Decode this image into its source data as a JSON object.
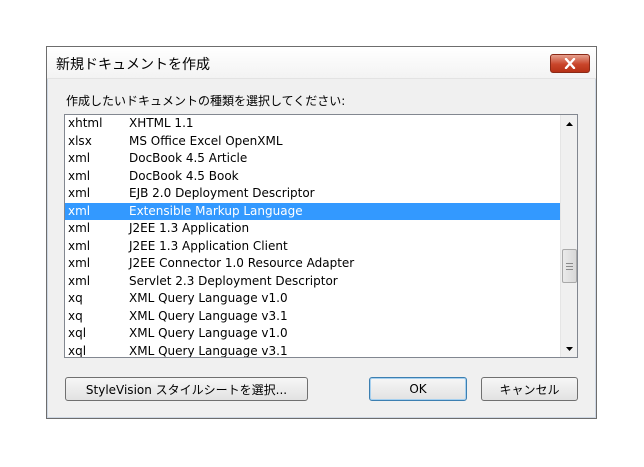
{
  "dialog": {
    "title": "新規ドキュメントを作成",
    "prompt": "作成したいドキュメントの種類を選択してください:"
  },
  "list": {
    "selected_index": 5,
    "rows": [
      {
        "type": "xhtml",
        "name": "XHTML 1.1"
      },
      {
        "type": "xlsx",
        "name": "MS Office Excel OpenXML"
      },
      {
        "type": "xml",
        "name": "DocBook 4.5 Article"
      },
      {
        "type": "xml",
        "name": "DocBook 4.5 Book"
      },
      {
        "type": "xml",
        "name": "EJB 2.0 Deployment Descriptor"
      },
      {
        "type": "xml",
        "name": "Extensible Markup Language"
      },
      {
        "type": "xml",
        "name": "J2EE 1.3 Application"
      },
      {
        "type": "xml",
        "name": "J2EE 1.3 Application Client"
      },
      {
        "type": "xml",
        "name": "J2EE Connector 1.0 Resource Adapter"
      },
      {
        "type": "xml",
        "name": "Servlet 2.3 Deployment Descriptor"
      },
      {
        "type": "xq",
        "name": "XML Query Language v1.0"
      },
      {
        "type": "xq",
        "name": "XML Query Language v3.1"
      },
      {
        "type": "xql",
        "name": "XML Query Language v1.0"
      },
      {
        "type": "xql",
        "name": "XML Query Language v3.1"
      }
    ]
  },
  "buttons": {
    "stylevision": "StyleVision スタイルシートを選択...",
    "ok": "OK",
    "cancel": "キャンセル"
  },
  "colors": {
    "selection": "#3399ff",
    "close_button": "#c9452a"
  },
  "icons": {
    "close": "close-icon",
    "scroll_up": "scroll-up-arrow-icon",
    "scroll_down": "scroll-down-arrow-icon",
    "thumb_grip": "grip-icon"
  }
}
